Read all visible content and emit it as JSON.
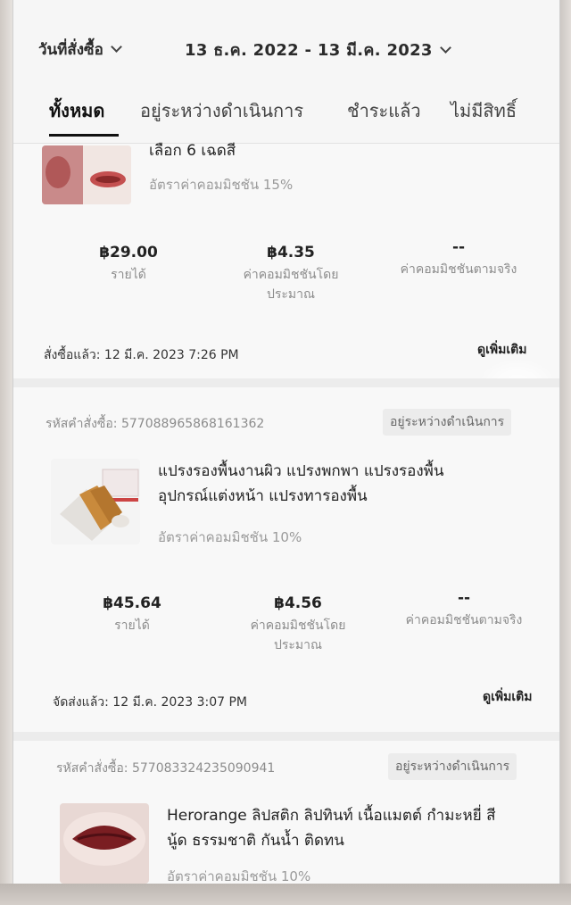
{
  "filter": {
    "date_label": "วันที่สั่งซื้อ",
    "date_range": "13 ธ.ค. 2022 - 13 มี.ค. 2023"
  },
  "tabs": [
    {
      "label": "ทั้งหมด",
      "active": true
    },
    {
      "label": "อยู่ระหว่างดำเนินการ",
      "active": false
    },
    {
      "label": "ชำระแล้ว",
      "active": false
    },
    {
      "label": "ไม่มีสิทธิ์",
      "active": false
    }
  ],
  "orders": [
    {
      "title_lines": [
        "เลือก 6 เฉดสี"
      ],
      "commission_rate": "อัตราค่าคอมมิชชัน 15%",
      "income_value": "฿29.00",
      "income_label": "รายได้",
      "est_commission_value": "฿4.35",
      "est_commission_label_1": "ค่าคอมมิชชันโดย",
      "est_commission_label_2": "ประมาณ",
      "actual_commission_value": "--",
      "actual_commission_label": "ค่าคอมมิชชันตามจริง",
      "footer_text": "สั่งซื้อแล้ว: 12 มี.ค. 2023 7:26 PM",
      "footer_link": "ดูเพิ่มเติม"
    },
    {
      "order_id": "รหัสคำสั่งซื้อ: 577088965868161362",
      "status": "อยู่ระหว่างดำเนินการ",
      "title_lines": [
        "แปรงรองพื้นงานผิว แปรงพกพา แปรงรองพื้น",
        "อุปกรณ์แต่งหน้า แปรงทารองพื้น"
      ],
      "commission_rate": "อัตราค่าคอมมิชชัน 10%",
      "income_value": "฿45.64",
      "income_label": "รายได้",
      "est_commission_value": "฿4.56",
      "est_commission_label_1": "ค่าคอมมิชชันโดย",
      "est_commission_label_2": "ประมาณ",
      "actual_commission_value": "--",
      "actual_commission_label": "ค่าคอมมิชชันตามจริง",
      "footer_text": "จัดส่งแล้ว: 12 มี.ค. 2023 3:07 PM",
      "footer_link": "ดูเพิ่มเติม"
    },
    {
      "order_id": "รหัสคำสั่งซื้อ: 577083324235090941",
      "status": "อยู่ระหว่างดำเนินการ",
      "title_lines": [
        "Herorange ลิปสติก ลิปทินท์ เนื้อแมตต์ กำมะหยี่ สี",
        "นู้ด ธรรมชาติ กันน้ำ ติดทน"
      ],
      "commission_rate": "อัตราค่าคอมมิชชัน 10%"
    }
  ],
  "colors": {
    "text_primary": "#222222",
    "text_secondary": "#8c8c8c",
    "background": "#f6f6f6",
    "separator": "#ececec"
  }
}
